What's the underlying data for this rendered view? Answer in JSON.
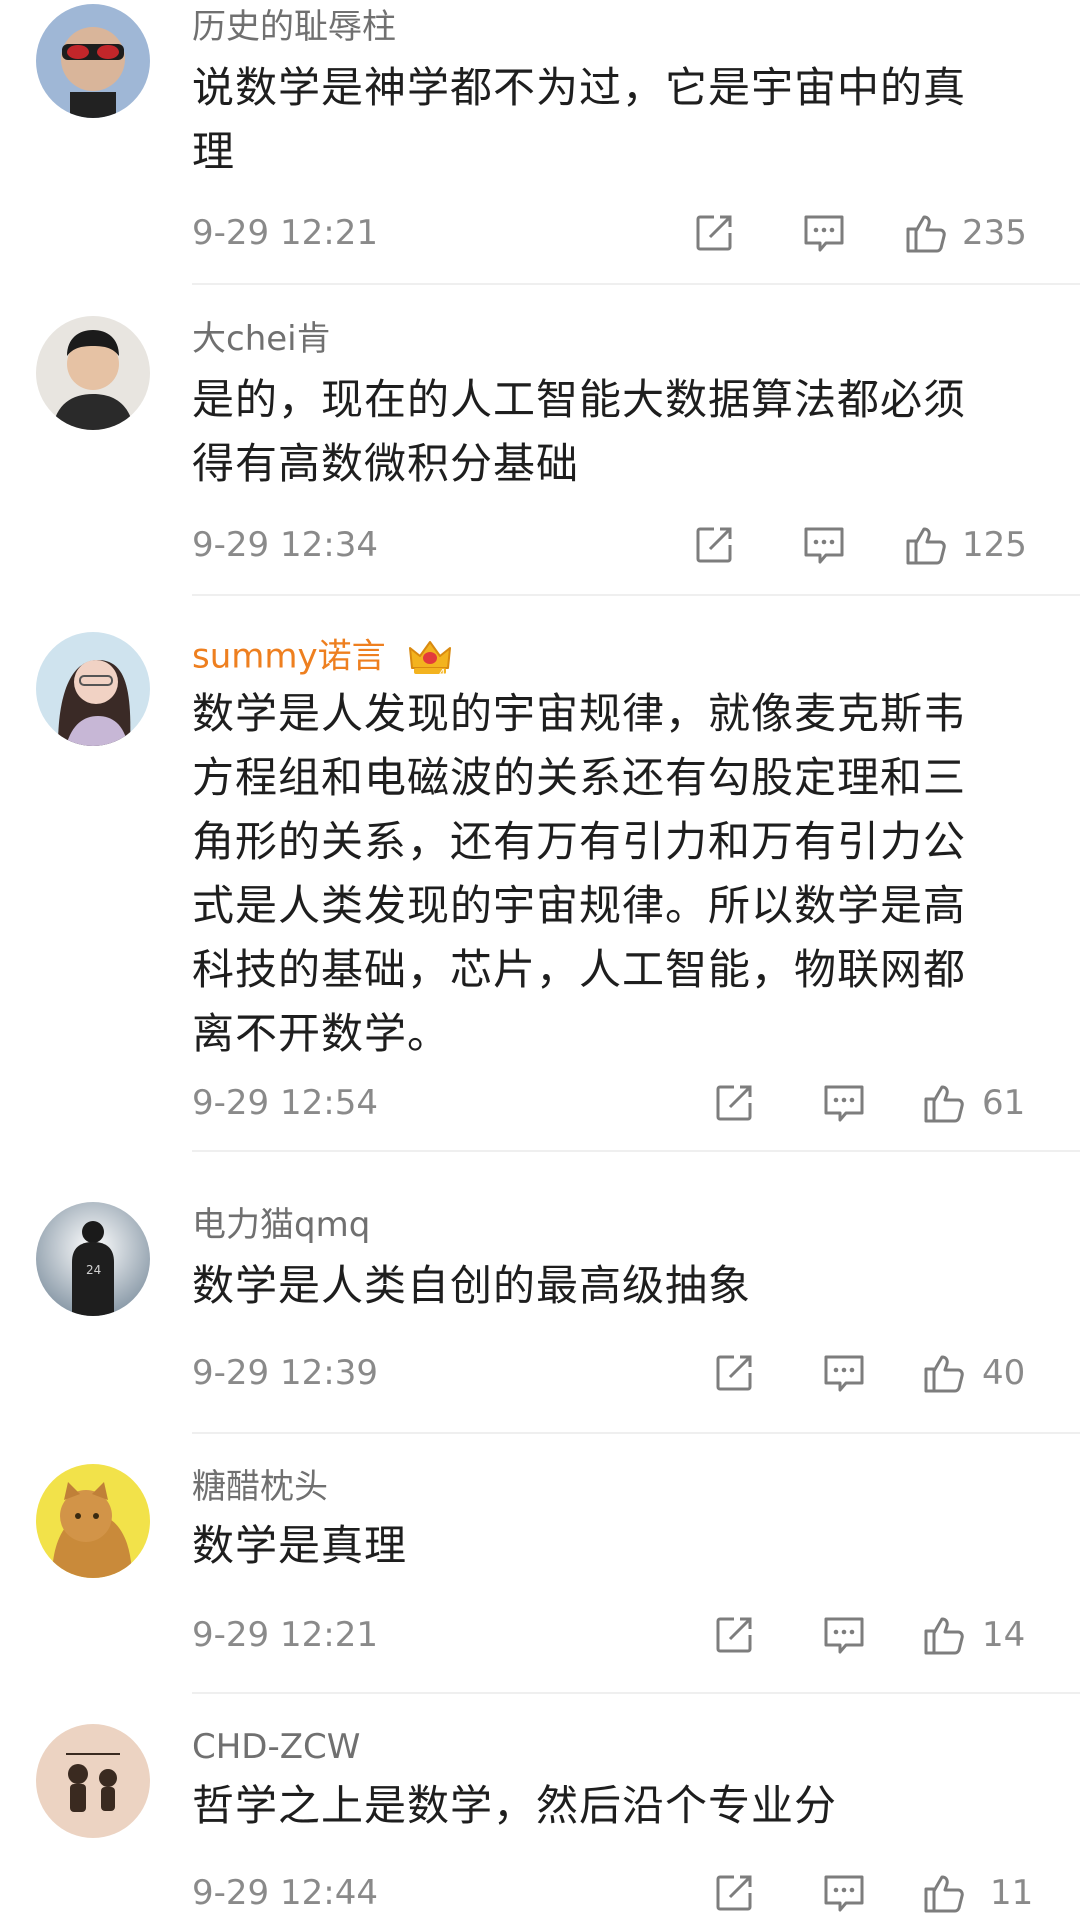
{
  "comments": [
    {
      "username": "历史的耻辱柱",
      "text": "说数学是神学都不为过，它是宇宙中的真理",
      "time": "9-29 12:21",
      "likes": "235"
    },
    {
      "username": "大chei肯",
      "text": "是的，现在的人工智能大数据算法都必须得有高数微积分基础",
      "time": "9-29 12:34",
      "likes": "125"
    },
    {
      "username": "summy诺言",
      "vip_badge": "crown-icon",
      "text": "数学是人发现的宇宙规律，就像麦克斯韦方程组和电磁波的关系还有勾股定理和三角形的关系，还有万有引力和万有引力公式是人类发现的宇宙规律。所以数学是高科技的基础，芯片，人工智能，物联网都离不开数学。",
      "time": "9-29 12:54",
      "likes": "61"
    },
    {
      "username": "电力猫qmq",
      "text": "数学是人类自创的最高级抽象",
      "time": "9-29 12:39",
      "likes": "40"
    },
    {
      "username": "糖醋枕头",
      "text": "数学是真理",
      "time": "9-29 12:21",
      "likes": "14"
    },
    {
      "username": "CHD-ZCW",
      "text": "哲学之上是数学，然后沿个专业分",
      "time": "9-29 12:44",
      "likes": "11"
    }
  ],
  "icons": {
    "share": "share-icon",
    "reply": "comment-icon",
    "like": "thumbs-up-icon"
  },
  "colors": {
    "vip_username": "#ee7f1f",
    "meta": "#8a8a8a"
  }
}
